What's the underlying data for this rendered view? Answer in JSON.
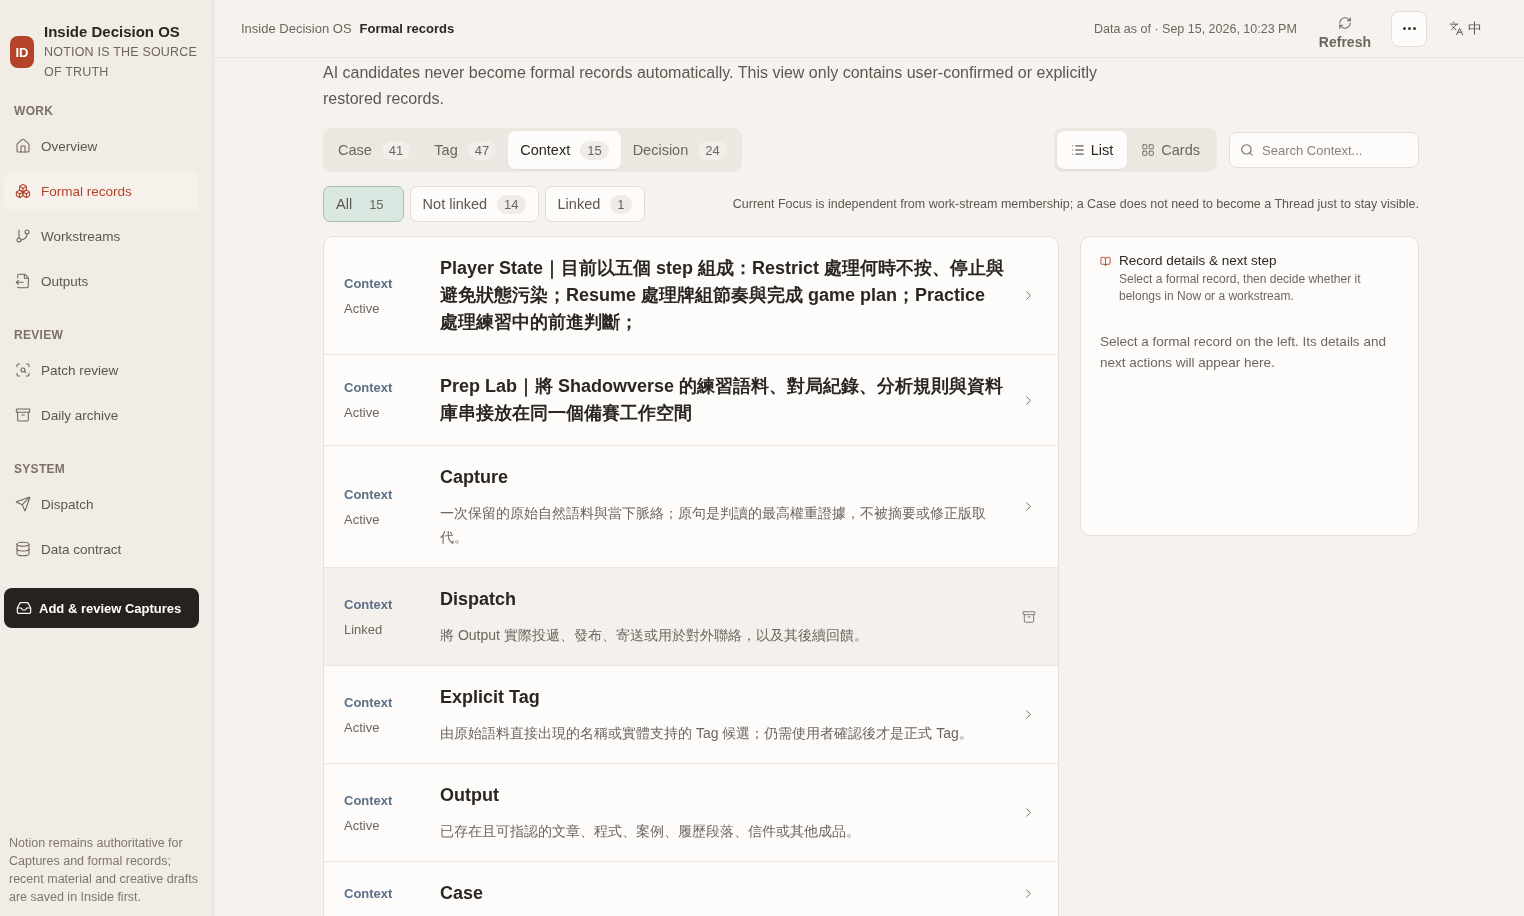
{
  "brand": {
    "initials": "ID",
    "name": "Inside Decision OS",
    "tagline": "NOTION IS THE SOURCE OF TRUTH"
  },
  "nav": [
    {
      "heading": "WORK",
      "items": [
        {
          "label": "Overview",
          "selected": false
        },
        {
          "label": "Formal records",
          "selected": true
        },
        {
          "label": "Workstreams",
          "selected": false
        },
        {
          "label": "Outputs",
          "selected": false
        }
      ]
    },
    {
      "heading": "REVIEW",
      "items": [
        {
          "label": "Patch review",
          "selected": false
        },
        {
          "label": "Daily archive",
          "selected": false
        }
      ]
    },
    {
      "heading": "SYSTEM",
      "items": [
        {
          "label": "Dispatch",
          "selected": false
        },
        {
          "label": "Data contract",
          "selected": false
        }
      ]
    }
  ],
  "primary_action": "Add & review Captures",
  "sidebar_note": "Notion remains authoritative for Captures and formal records; recent material and creative drafts are saved in Inside first.",
  "header": {
    "breadcrumb": [
      "Inside Decision OS",
      "Formal records"
    ],
    "data_as_of": "Data as of · Sep 15, 2026, 10:23 PM",
    "refresh": "Refresh",
    "language": "中"
  },
  "intro": "AI candidates never become formal records automatically. This view only contains user-confirmed or explicitly restored records.",
  "type_tabs": [
    {
      "label": "Case",
      "count": "41",
      "selected": false
    },
    {
      "label": "Tag",
      "count": "47",
      "selected": false
    },
    {
      "label": "Context",
      "count": "15",
      "selected": true
    },
    {
      "label": "Decision",
      "count": "24",
      "selected": false
    }
  ],
  "view_toggle": [
    {
      "label": "List",
      "selected": true
    },
    {
      "label": "Cards",
      "selected": false
    }
  ],
  "search": {
    "placeholder": "Search Context..."
  },
  "link_filters": [
    {
      "label": "All",
      "count": "15",
      "selected": true
    },
    {
      "label": "Not linked",
      "count": "14",
      "selected": false
    },
    {
      "label": "Linked",
      "count": "1",
      "selected": false
    }
  ],
  "focus_note": "Current Focus is independent from work-stream membership; a Case does not need to become a Thread just to stay visible.",
  "records": [
    {
      "type": "Context",
      "status": "Active",
      "title": "Player State｜目前以五個 step 組成：Restrict 處理何時不按、停止與避免狀態污染；Resume 處理牌組節奏與完成 game plan；Practice 處理練習中的前進判斷；",
      "highlighted": false
    },
    {
      "type": "Context",
      "status": "Active",
      "title": "Prep Lab｜將 Shadowverse 的練習語料、對局紀錄、分析規則與資料庫串接放在同一個備賽工作空間",
      "highlighted": false
    },
    {
      "type": "Context",
      "status": "Active",
      "title": "Capture",
      "description": "一次保留的原始自然語料與當下脈絡；原句是判讀的最高權重證據，不被摘要或修正版取代。",
      "highlighted": false
    },
    {
      "type": "Context",
      "status": "Linked",
      "title": "Dispatch",
      "description": "將 Output 實際投遞、發布、寄送或用於對外聯絡，以及其後續回饋。",
      "highlighted": true
    },
    {
      "type": "Context",
      "status": "Active",
      "title": "Explicit Tag",
      "description": "由原始語料直接出現的名稱或實體支持的 Tag 候選；仍需使用者確認後才是正式 Tag。",
      "highlighted": false
    },
    {
      "type": "Context",
      "status": "Active",
      "title": "Output",
      "description": "已存在且可指認的文章、程式、案例、履歷段落、信件或其他成品。",
      "highlighted": false
    },
    {
      "type": "Context",
      "title": "Case",
      "highlighted": false
    }
  ],
  "detail_panel": {
    "title": "Record details & next step",
    "subtitle": "Select a formal record, then decide whether it belongs in Now or a workstream.",
    "empty_message": "Select a formal record on the left. Its details and next actions will appear here."
  }
}
